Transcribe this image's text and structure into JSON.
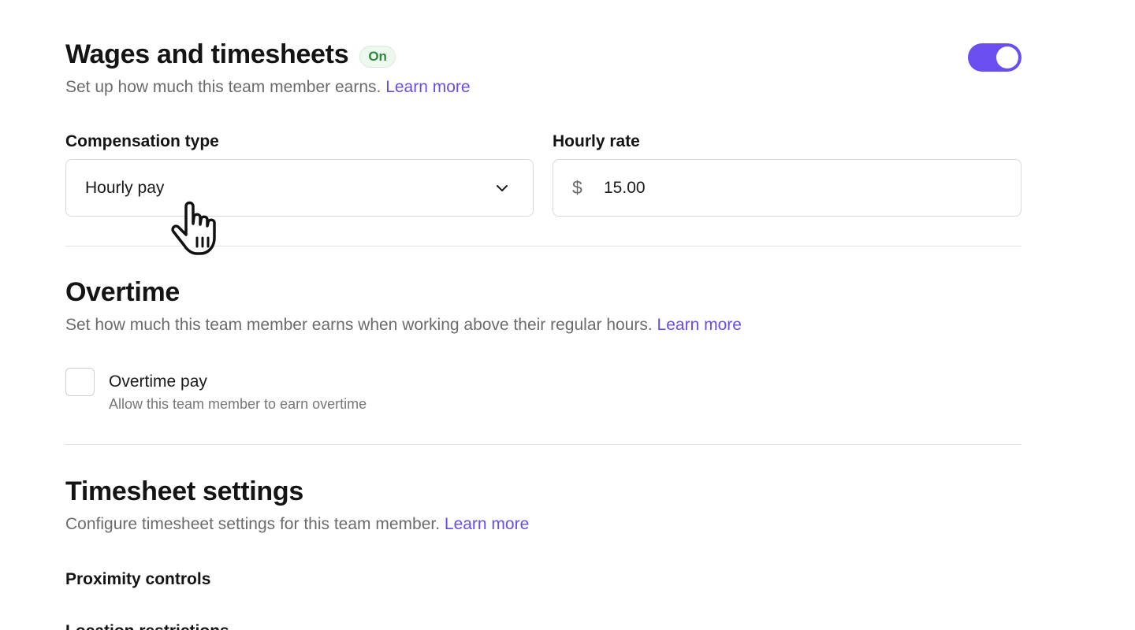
{
  "wages": {
    "title": "Wages and timesheets",
    "badge": "On",
    "description": "Set up how much this team member earns.",
    "learn_more": "Learn more",
    "toggle_on": true
  },
  "compensation": {
    "label": "Compensation type",
    "selected": "Hourly pay"
  },
  "hourly_rate": {
    "label": "Hourly rate",
    "currency_symbol": "$",
    "value": "15.00"
  },
  "overtime": {
    "title": "Overtime",
    "description": "Set how much this team member earns when working above their regular hours.",
    "learn_more": "Learn more",
    "checkbox_label": "Overtime pay",
    "checkbox_help": "Allow this team member to earn overtime",
    "checked": false
  },
  "timesheet": {
    "title": "Timesheet settings",
    "description": "Configure timesheet settings for this team member.",
    "learn_more": "Learn more",
    "proximity_label": "Proximity controls",
    "next_label": "Location restrictions"
  },
  "colors": {
    "accent": "#6b4ef0",
    "link": "#6a4de8",
    "badge_text": "#2b8a3e"
  },
  "icons": {
    "dropdown": "chevron-down-icon",
    "cursor": "hand-pointer-icon"
  }
}
